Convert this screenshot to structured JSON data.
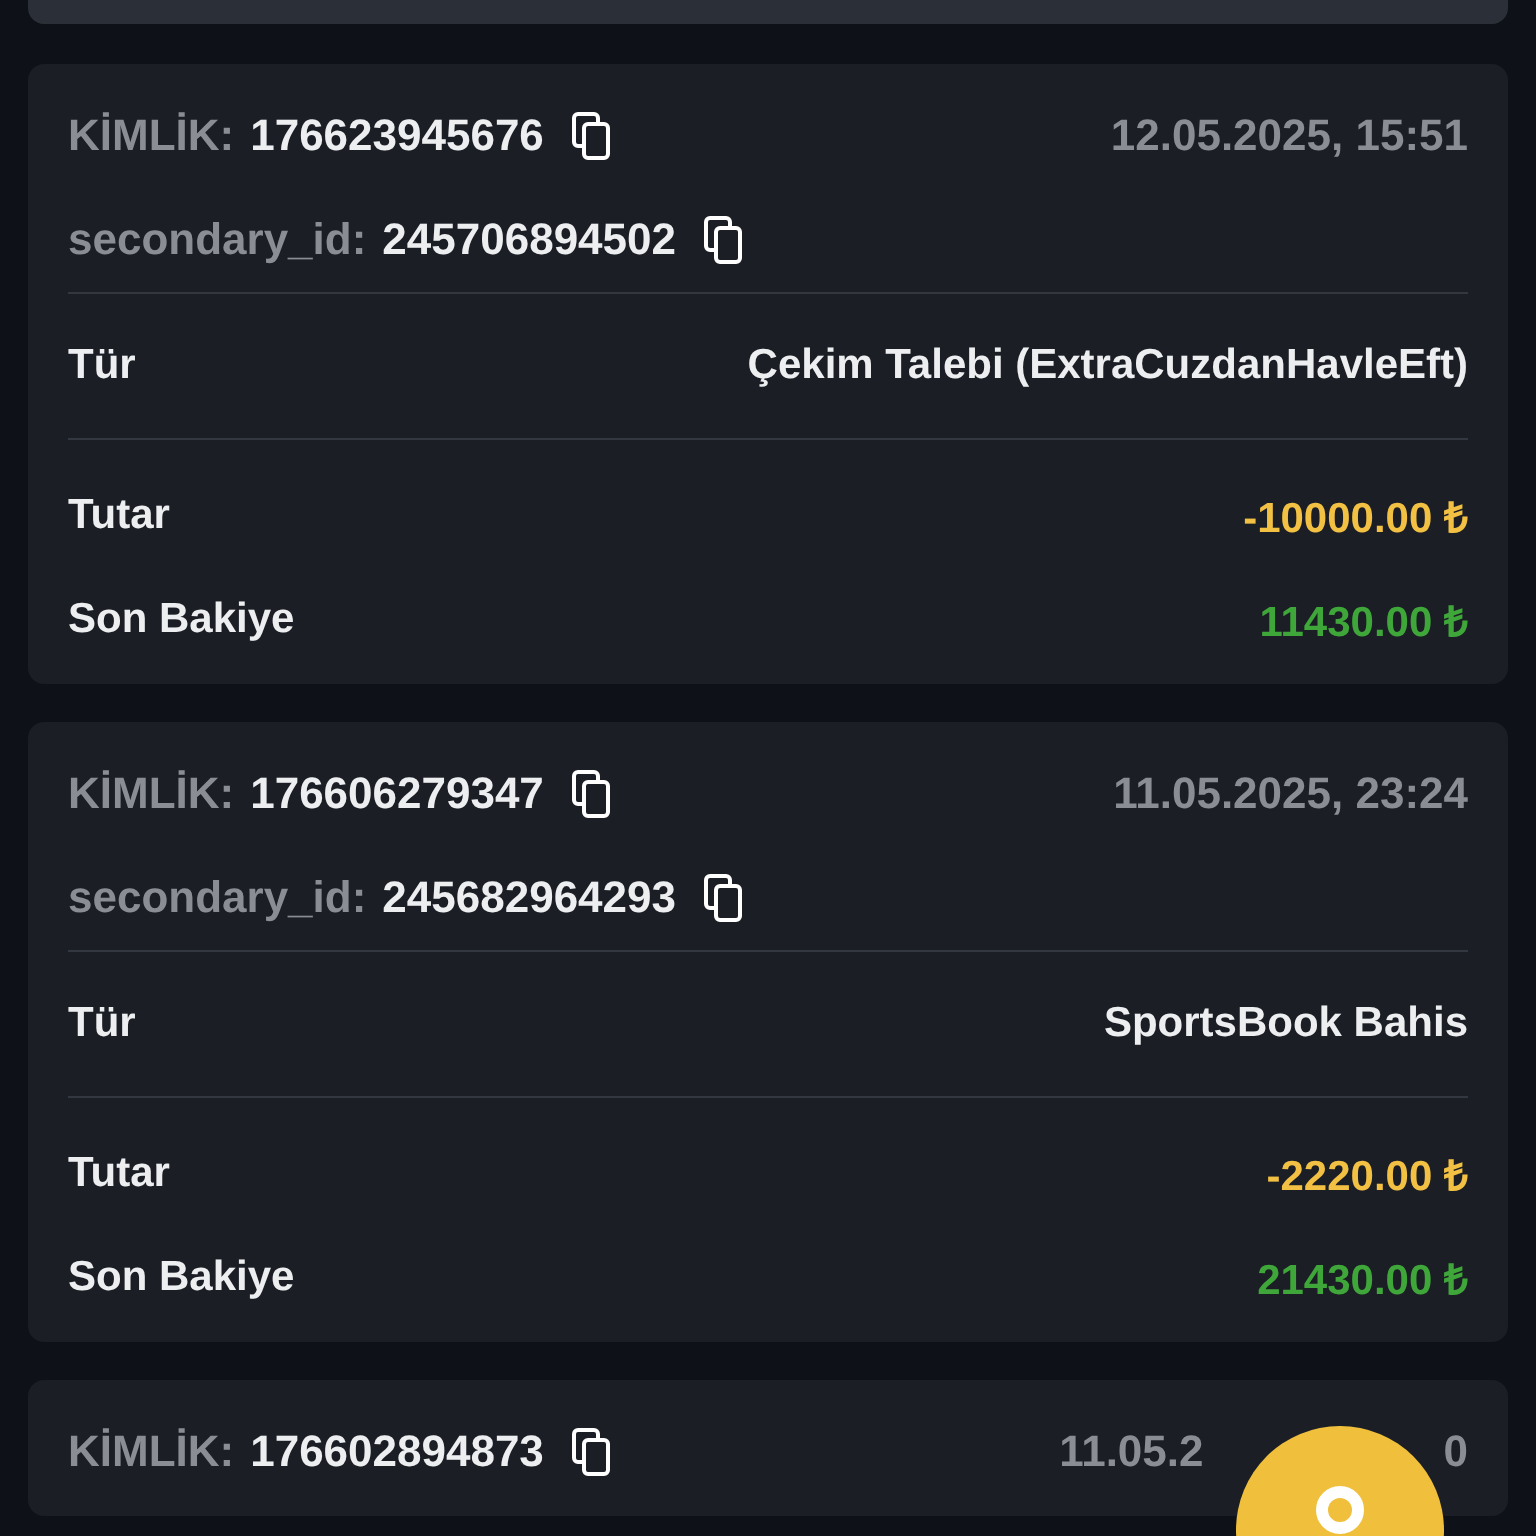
{
  "cards": [
    {
      "id_label": "KİMLİK:",
      "id": "176623945676",
      "date": [
        "12.05.2025, 15:51"
      ],
      "secondary_label": "secondary_id:",
      "secondary_id": "245706894502",
      "type_label": "Tür",
      "type": "Çekim Talebi (ExtraCuzdanHavleEft)",
      "amount_label": "Tutar",
      "amount": "-10000.00 ₺",
      "balance_label": "Son Bakiye",
      "balance": "11430.00 ₺"
    },
    {
      "id_label": "KİMLİK:",
      "id": "176606279347",
      "date": [
        "11.05.2025, 23:24"
      ],
      "secondary_label": "secondary_id:",
      "secondary_id": "245682964293",
      "type_label": "Tür",
      "type": "SportsBook Bahis",
      "amount_label": "Tutar",
      "amount": "-2220.00 ₺",
      "balance_label": "Son Bakiye",
      "balance": "21430.00 ₺"
    },
    {
      "id_label": "KİMLİK:",
      "id": "176602894873",
      "date": [
        "11.05.2",
        "0"
      ]
    }
  ]
}
